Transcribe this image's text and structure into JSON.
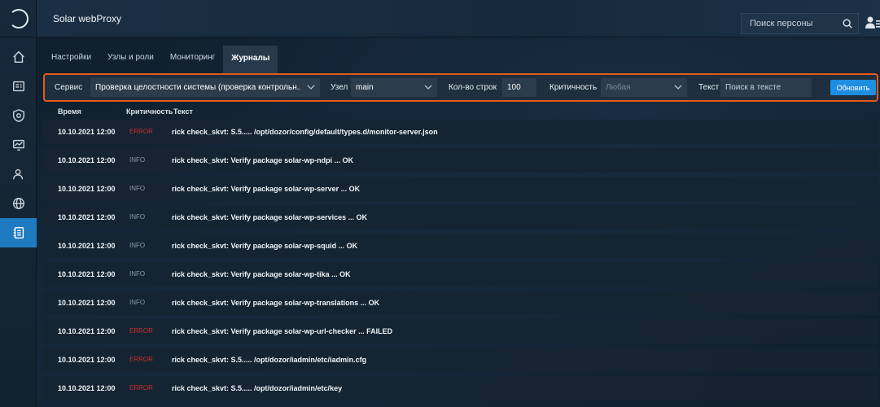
{
  "app": {
    "title": "Solar webProxy"
  },
  "header": {
    "search_placeholder": "Поиск персоны"
  },
  "tabs": [
    {
      "label": "Настройки"
    },
    {
      "label": "Узлы и роли"
    },
    {
      "label": "Мониторинг"
    },
    {
      "label": "Журналы"
    }
  ],
  "filters": {
    "service_label": "Сервис",
    "service_value": "Проверка целостности системы (проверка контрольн...",
    "node_label": "Узел",
    "node_value": "main",
    "rows_label": "Кол-во строк",
    "rows_value": "100",
    "severity_label": "Критичность",
    "severity_placeholder": "Любая",
    "text_label": "Текст",
    "text_placeholder": "Поиск в тексте",
    "refresh_label": "Обновить"
  },
  "table": {
    "columns": [
      "Время",
      "Критичность",
      "Текст"
    ],
    "rows": [
      {
        "time": "10.10.2021 12:00",
        "severity": "ERROR",
        "text": "rick check_skvt: S.5..... /opt/dozor/config/default/types.d/monitor-server.json"
      },
      {
        "time": "10.10.2021 12:00",
        "severity": "INFO",
        "text": "rick check_skvt: Verify package solar-wp-ndpi ... OK"
      },
      {
        "time": "10.10.2021 12:00",
        "severity": "INFO",
        "text": "rick check_skvt: Verify package solar-wp-server ... OK"
      },
      {
        "time": "10.10.2021 12:00",
        "severity": "INFO",
        "text": "rick check_skvt: Verify package solar-wp-services ... OK"
      },
      {
        "time": "10.10.2021 12:00",
        "severity": "INFO",
        "text": "rick check_skvt: Verify package solar-wp-squid ... OK"
      },
      {
        "time": "10.10.2021 12:00",
        "severity": "INFO",
        "text": "rick check_skvt: Verify package solar-wp-tika ... OK"
      },
      {
        "time": "10.10.2021 12:00",
        "severity": "INFO",
        "text": "rick check_skvt: Verify package solar-wp-translations ... OK"
      },
      {
        "time": "10.10.2021 12:00",
        "severity": "ERROR",
        "text": "rick check_skvt: Verify package solar-wp-url-checker ... FAILED"
      },
      {
        "time": "10.10.2021 12:00",
        "severity": "ERROR",
        "text": "rick check_skvt: S.5..... /opt/dozor/iadmin/etc/iadmin.cfg"
      },
      {
        "time": "10.10.2021 12:00",
        "severity": "ERROR",
        "text": "rick check_skvt: S.5..... /opt/dozor/iadmin/etc/key"
      }
    ]
  },
  "colors": {
    "accent": "#1e8ee0",
    "highlight_border": "#e45a1c",
    "error": "#c9302c",
    "info": "#8e9aa6"
  }
}
